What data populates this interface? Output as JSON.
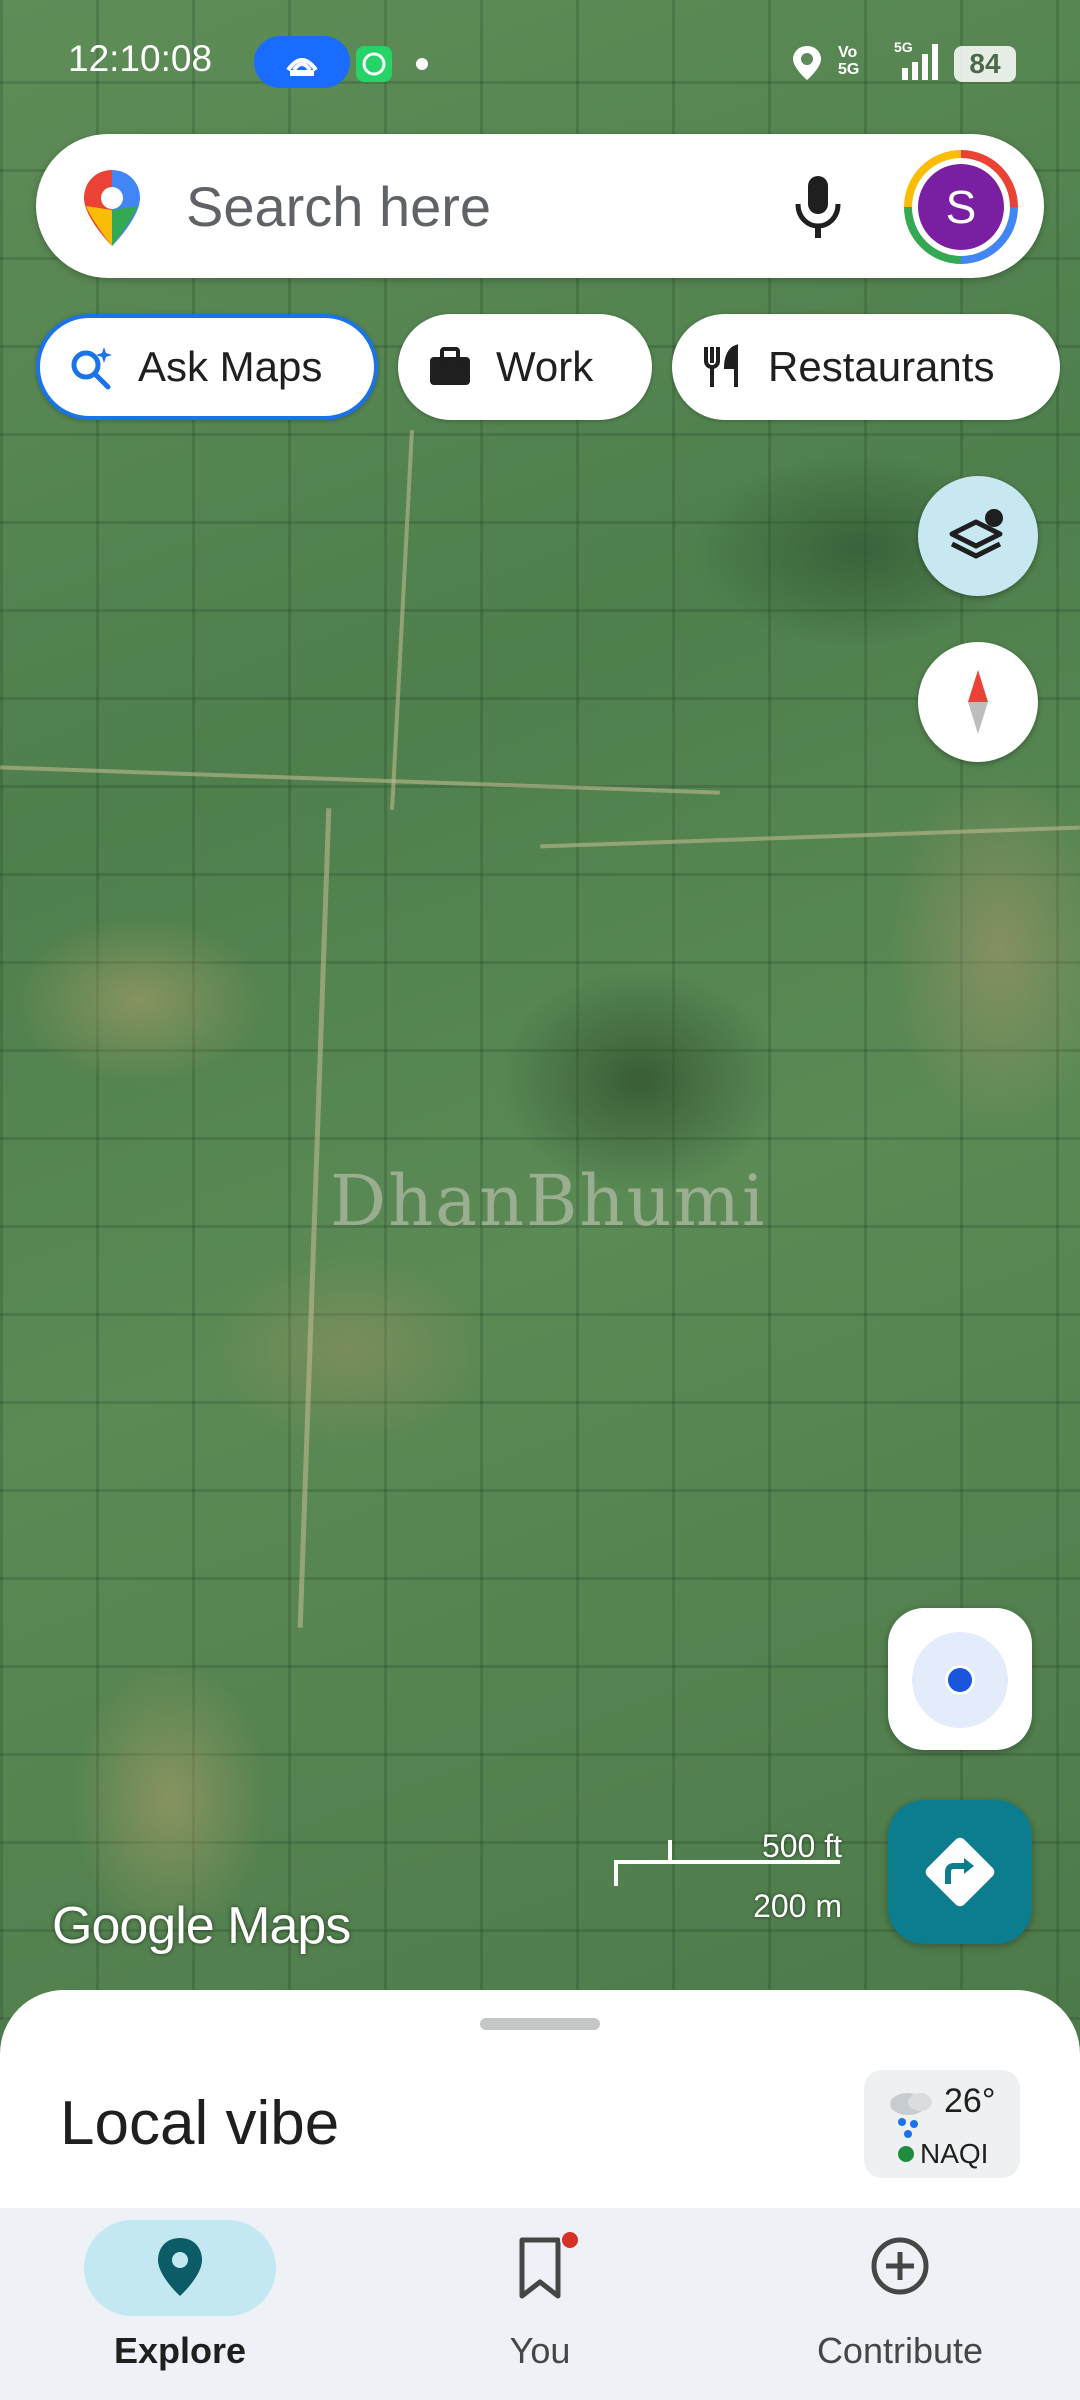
{
  "status_bar": {
    "time": "12:10:08",
    "network": "5G",
    "volte": "Vo 5G",
    "battery": "84",
    "icons": [
      "hotspot-icon",
      "whatsapp-icon",
      "dot-icon",
      "location-icon",
      "signal-icon",
      "battery-icon"
    ]
  },
  "search": {
    "placeholder": "Search here",
    "avatar_letter": "S",
    "avatar_color": "#7b1fa2"
  },
  "chips": [
    {
      "label": "Ask Maps",
      "icon": "sparkle-search-icon",
      "selected": true
    },
    {
      "label": "Work",
      "icon": "briefcase-icon"
    },
    {
      "label": "Restaurants",
      "icon": "fork-knife-icon"
    }
  ],
  "map": {
    "watermark": "DhanBhumi",
    "scale_ft": "500 ft",
    "scale_m": "200 m",
    "logo": "Google Maps",
    "view": "satellite"
  },
  "sheet": {
    "title": "Local vibe",
    "weather_temp": "26°",
    "aqi_label": "NAQI",
    "aqi_color": "#1e8e3e"
  },
  "nav": {
    "items": [
      {
        "label": "Explore",
        "icon": "explore-pin-icon",
        "active": true
      },
      {
        "label": "You",
        "icon": "bookmark-icon",
        "badge": true
      },
      {
        "label": "Contribute",
        "icon": "add-circle-icon"
      }
    ]
  },
  "colors": {
    "accent_blue": "#1a73e8",
    "directions_teal": "#0b7d8e",
    "layers_bg": "#c7e7f1",
    "nav_active_pill": "#c3e8f2"
  }
}
